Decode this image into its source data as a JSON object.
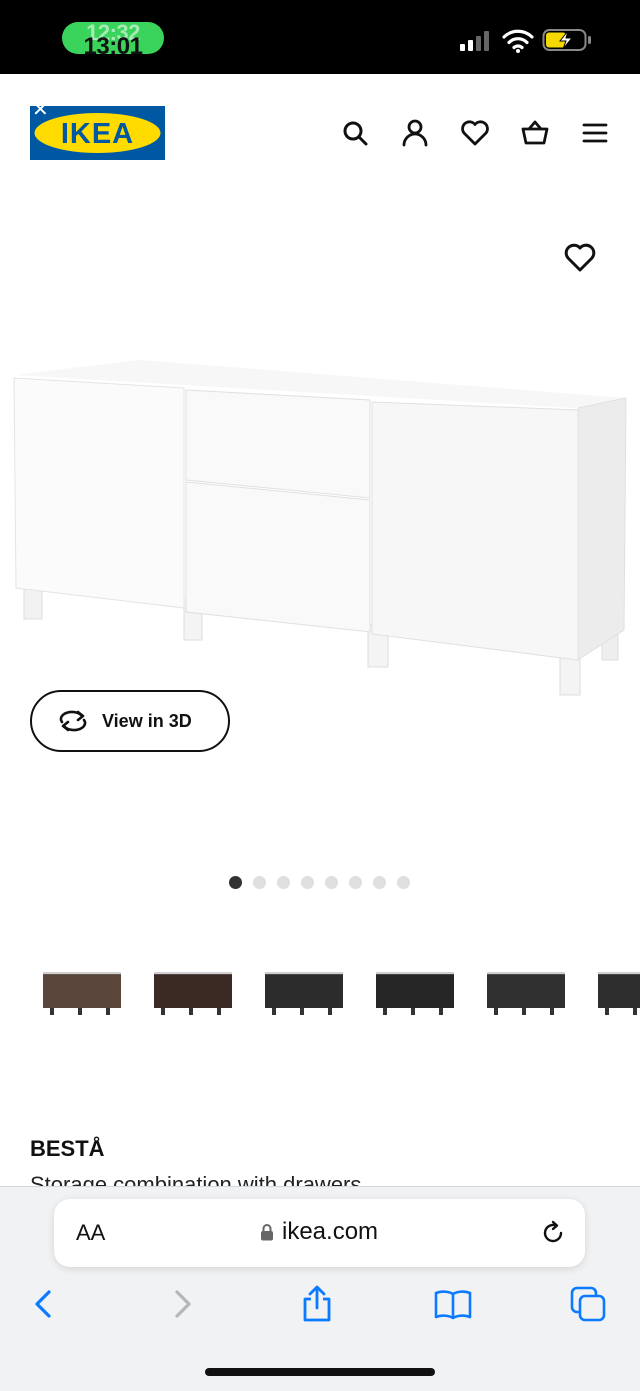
{
  "status_bar": {
    "time": "13:01",
    "time_ghost": "12:32"
  },
  "header": {
    "logo_text": "IKEA",
    "icons": [
      "search-icon",
      "profile-icon",
      "favourites-icon",
      "basket-icon",
      "menu-icon"
    ]
  },
  "product": {
    "view_3d_label": "View in 3D",
    "image_count": 8,
    "active_image": 1,
    "name": "BESTÅ",
    "description": "Storage combination with drawers",
    "variant_colors": [
      "#5a463b",
      "#3b2a24",
      "#2c2c2c",
      "#262626",
      "#303030",
      "#2e2e2e"
    ]
  },
  "browser": {
    "text_size_label": "AA",
    "url": "ikea.com",
    "icons": [
      "back-icon",
      "forward-icon",
      "share-icon",
      "bookmarks-icon",
      "tabs-icon"
    ]
  },
  "colors": {
    "ikea_blue": "#0058a3",
    "ikea_yellow": "#ffdb00",
    "ios_blue": "#0a7aff"
  }
}
